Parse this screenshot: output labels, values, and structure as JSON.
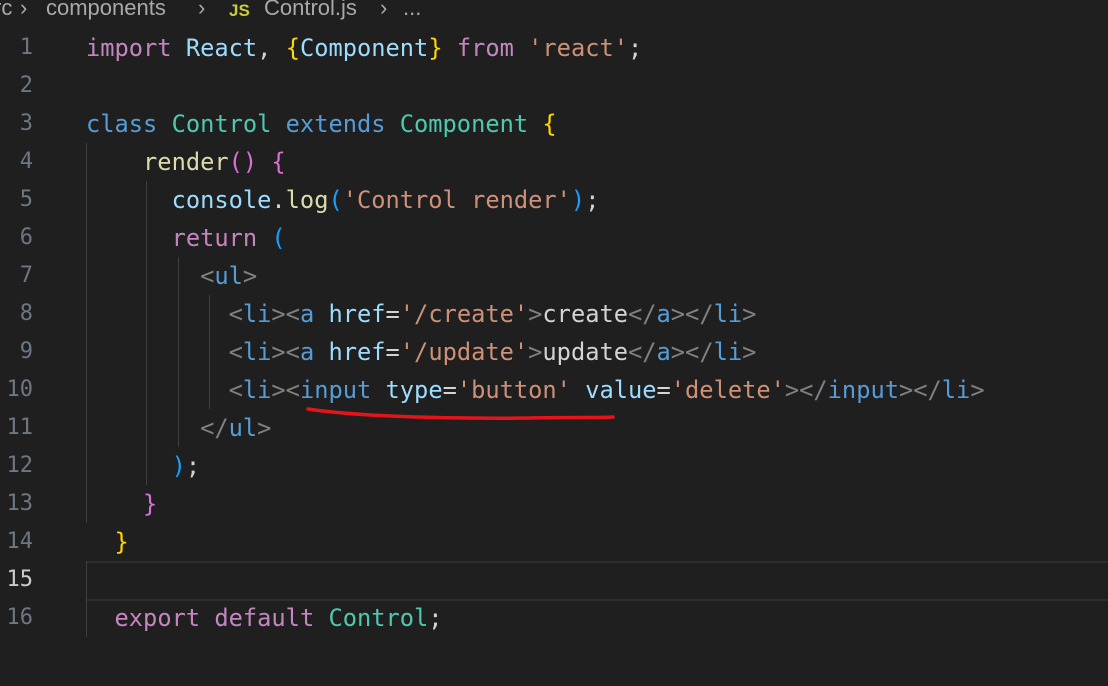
{
  "breadcrumb": {
    "folder_fragment": "rc",
    "folder": "components",
    "file_icon": "JS",
    "file": "Control.js",
    "ellipsis": "..."
  },
  "editor": {
    "language": "javascript",
    "active_line": 15,
    "lines": [
      {
        "n": "1",
        "tokens": [
          [
            "kw",
            "import"
          ],
          [
            "plain",
            " "
          ],
          [
            "id",
            "React"
          ],
          [
            "plain",
            ", "
          ],
          [
            "b1",
            "{"
          ],
          [
            "id",
            "Component"
          ],
          [
            "b1",
            "}"
          ],
          [
            "plain",
            " "
          ],
          [
            "kw",
            "from"
          ],
          [
            "plain",
            " "
          ],
          [
            "str",
            "'react'"
          ],
          [
            "plain",
            ";"
          ]
        ]
      },
      {
        "n": "2",
        "tokens": []
      },
      {
        "n": "3",
        "tokens": [
          [
            "st",
            "class"
          ],
          [
            "plain",
            " "
          ],
          [
            "cls",
            "Control"
          ],
          [
            "plain",
            " "
          ],
          [
            "st",
            "extends"
          ],
          [
            "plain",
            " "
          ],
          [
            "cls",
            "Component"
          ],
          [
            "plain",
            " "
          ],
          [
            "b1",
            "{"
          ]
        ]
      },
      {
        "n": "4",
        "tokens": [
          [
            "plain",
            "    "
          ],
          [
            "fn",
            "render"
          ],
          [
            "b2",
            "()"
          ],
          [
            "plain",
            " "
          ],
          [
            "b2",
            "{"
          ]
        ]
      },
      {
        "n": "5",
        "tokens": [
          [
            "plain",
            "      "
          ],
          [
            "id",
            "console"
          ],
          [
            "plain",
            "."
          ],
          [
            "fn",
            "log"
          ],
          [
            "b3",
            "("
          ],
          [
            "str",
            "'Control render'"
          ],
          [
            "b3",
            ")"
          ],
          [
            "plain",
            ";"
          ]
        ]
      },
      {
        "n": "6",
        "tokens": [
          [
            "plain",
            "      "
          ],
          [
            "kw",
            "return"
          ],
          [
            "plain",
            " "
          ],
          [
            "b3",
            "("
          ]
        ]
      },
      {
        "n": "7",
        "tokens": [
          [
            "plain",
            "        "
          ],
          [
            "pun",
            "<"
          ],
          [
            "tag",
            "ul"
          ],
          [
            "pun",
            ">"
          ]
        ]
      },
      {
        "n": "8",
        "tokens": [
          [
            "plain",
            "          "
          ],
          [
            "pun",
            "<"
          ],
          [
            "tag",
            "li"
          ],
          [
            "pun",
            "><"
          ],
          [
            "tag",
            "a"
          ],
          [
            "plain",
            " "
          ],
          [
            "id",
            "href"
          ],
          [
            "plain",
            "="
          ],
          [
            "str",
            "'/create'"
          ],
          [
            "pun",
            ">"
          ],
          [
            "plain",
            "create"
          ],
          [
            "pun",
            "</"
          ],
          [
            "tag",
            "a"
          ],
          [
            "pun",
            "></"
          ],
          [
            "tag",
            "li"
          ],
          [
            "pun",
            ">"
          ]
        ]
      },
      {
        "n": "9",
        "tokens": [
          [
            "plain",
            "          "
          ],
          [
            "pun",
            "<"
          ],
          [
            "tag",
            "li"
          ],
          [
            "pun",
            "><"
          ],
          [
            "tag",
            "a"
          ],
          [
            "plain",
            " "
          ],
          [
            "id",
            "href"
          ],
          [
            "plain",
            "="
          ],
          [
            "str",
            "'/update'"
          ],
          [
            "pun",
            ">"
          ],
          [
            "plain",
            "update"
          ],
          [
            "pun",
            "</"
          ],
          [
            "tag",
            "a"
          ],
          [
            "pun",
            "></"
          ],
          [
            "tag",
            "li"
          ],
          [
            "pun",
            ">"
          ]
        ]
      },
      {
        "n": "10",
        "tokens": [
          [
            "plain",
            "          "
          ],
          [
            "pun",
            "<"
          ],
          [
            "tag",
            "li"
          ],
          [
            "pun",
            "><"
          ],
          [
            "tag",
            "input"
          ],
          [
            "plain",
            " "
          ],
          [
            "id",
            "type"
          ],
          [
            "plain",
            "="
          ],
          [
            "str",
            "'button'"
          ],
          [
            "plain",
            " "
          ],
          [
            "id",
            "value"
          ],
          [
            "plain",
            "="
          ],
          [
            "str",
            "'delete'"
          ],
          [
            "pun",
            "></"
          ],
          [
            "tag",
            "input"
          ],
          [
            "pun",
            "></"
          ],
          [
            "tag",
            "li"
          ],
          [
            "pun",
            ">"
          ]
        ]
      },
      {
        "n": "11",
        "tokens": [
          [
            "plain",
            "        "
          ],
          [
            "pun",
            "</"
          ],
          [
            "tag",
            "ul"
          ],
          [
            "pun",
            ">"
          ]
        ]
      },
      {
        "n": "12",
        "tokens": [
          [
            "plain",
            "      "
          ],
          [
            "b3",
            ")"
          ],
          [
            "plain",
            ";"
          ]
        ]
      },
      {
        "n": "13",
        "tokens": [
          [
            "plain",
            "    "
          ],
          [
            "b2",
            "}"
          ]
        ]
      },
      {
        "n": "14",
        "tokens": [
          [
            "plain",
            "  "
          ],
          [
            "b1",
            "}"
          ]
        ]
      },
      {
        "n": "15",
        "tokens": []
      },
      {
        "n": "16",
        "tokens": [
          [
            "plain",
            "  "
          ],
          [
            "kw",
            "export"
          ],
          [
            "plain",
            " "
          ],
          [
            "kw",
            "default"
          ],
          [
            "plain",
            " "
          ],
          [
            "cls",
            "Control"
          ],
          [
            "plain",
            ";"
          ]
        ]
      }
    ]
  },
  "colors": {
    "background": "#1f1f1f",
    "annotation_underline": "#e5141a"
  }
}
